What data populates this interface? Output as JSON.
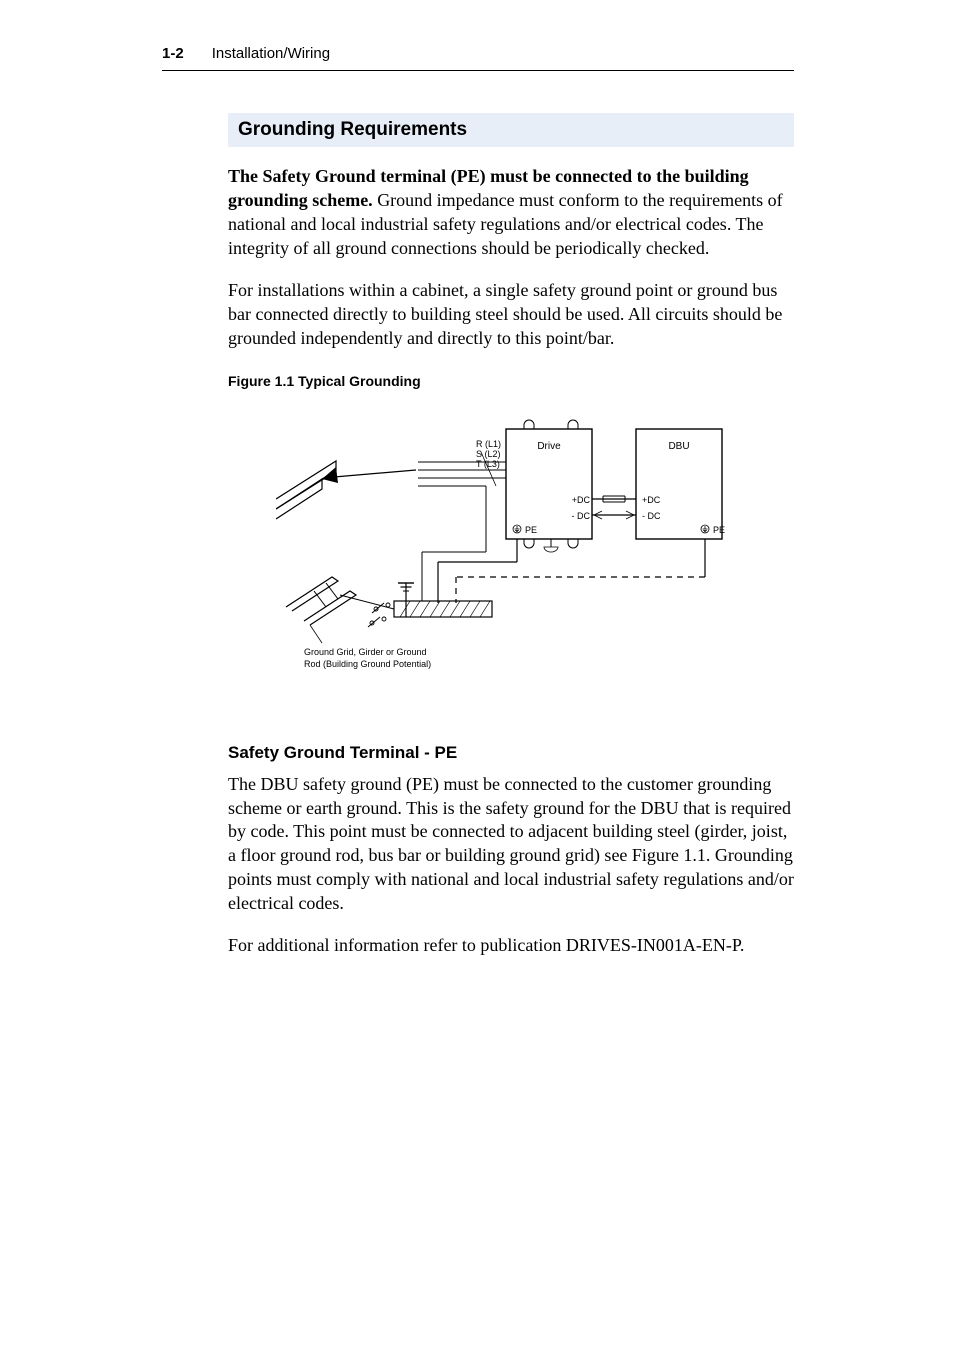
{
  "header": {
    "page_number": "1-2",
    "chapter_title": "Installation/Wiring"
  },
  "section": {
    "heading": "Grounding Requirements",
    "para1_lead": "The Safety Ground terminal (PE) must be connected to the building grounding scheme.",
    "para1_rest": " Ground impedance must conform to the requirements of national and local industrial safety regulations and/or electrical codes. The integrity of all ground connections should be periodically checked.",
    "para2": "For installations within a cabinet, a single safety ground point or ground bus bar connected directly to building steel should be used. All circuits should be grounded independently and directly to this point/bar.",
    "figure_caption": "Figure 1.1   Typical Grounding",
    "subheading": "Safety Ground Terminal - PE",
    "para3": "The DBU safety ground (PE) must be connected to the customer grounding scheme or earth ground. This is the safety ground for the DBU that is required by code. This point must be connected to adjacent building steel (girder, joist, a floor ground rod, bus bar or building ground grid) see Figure 1.1. Grounding points must comply with national and local industrial safety regulations and/or electrical codes.",
    "para4": "For additional information refer to publication DRIVES-IN001A-EN-P."
  },
  "figure": {
    "phase_labels": "R (L1)\nS (L2)\nT (L3)",
    "drive_label": "Drive",
    "dbu_label": "DBU",
    "pos_dc": "+DC",
    "neg_dc": "- DC",
    "pe_label": "PE",
    "ground_grid_label": "Ground Grid, Girder or Ground\nRod (Building Ground Potential)"
  }
}
